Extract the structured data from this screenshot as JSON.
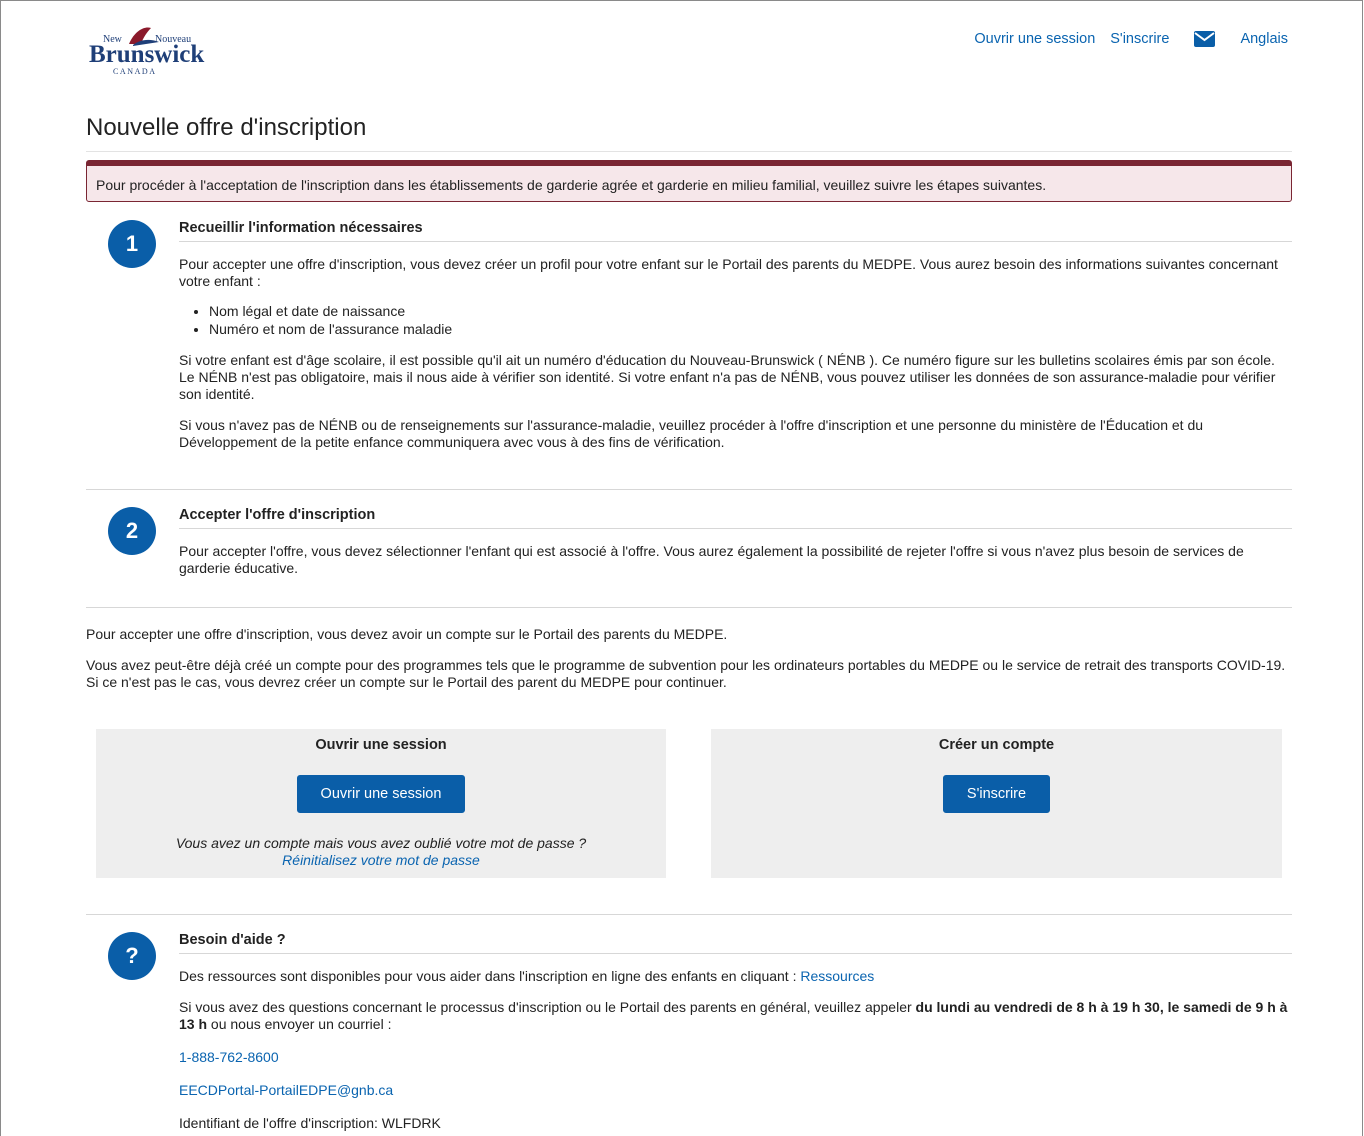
{
  "brand": {
    "logo_text_new": "New",
    "logo_text_nouveau": "Nouveau",
    "logo_text_main": "Brunswick",
    "logo_text_country": "C A N A D A"
  },
  "topnav": {
    "login": "Ouvrir une session",
    "register": "S'inscrire",
    "mail_icon": "envelope-icon",
    "language": "Anglais"
  },
  "page": {
    "title": "Nouvelle offre d'inscription",
    "alert": "Pour procéder à l'acceptation de l'inscription dans les établissements de garderie agrée et garderie en milieu familial, veuillez suivre les étapes suivantes."
  },
  "step1": {
    "number": "1",
    "heading": "Recueillir l'information nécessaires",
    "intro": "Pour accepter une offre d'inscription, vous devez créer un profil pour votre enfant sur le Portail des parents du MEDPE. Vous aurez besoin des informations suivantes concernant votre enfant :",
    "bullets": [
      "Nom légal et date de naissance",
      "Numéro et nom de l'assurance maladie"
    ],
    "para2": "Si votre enfant est d'âge scolaire, il est possible qu'il ait un numéro d'éducation du Nouveau-Brunswick ( NÉNB ). Ce numéro figure sur les bulletins scolaires émis par son école. Le NÉNB n'est pas obligatoire, mais il nous aide à vérifier son identité. Si votre enfant n'a pas de NÉNB, vous pouvez utiliser les données de son assurance-maladie pour vérifier son identité.",
    "para3": "Si vous n'avez pas de NÉNB ou de renseignements sur l'assurance-maladie, veuillez procéder à l'offre d'inscription et une personne du ministère de l'Éducation et du Développement de la petite enfance communiquera avec vous à des fins de vérification."
  },
  "step2": {
    "number": "2",
    "heading": "Accepter l'offre d'inscription",
    "text": "Pour accepter l'offre, vous devez sélectionner l'enfant qui est associé à l'offre. Vous aurez également la possibilité de rejeter l'offre si vous n'avez plus besoin de services de garderie éducative."
  },
  "account": {
    "line1": "Pour accepter une offre d'inscription, vous devez avoir un compte sur le Portail des parents du MEDPE.",
    "line2": "Vous avez peut-être déjà créé un compte pour des programmes tels que le programme de subvention pour les ordinateurs portables du MEDPE ou le service de retrait des transports COVID-19. Si ce n'est pas le cas, vous devrez créer un compte sur le Portail des parent du MEDPE pour continuer."
  },
  "login_card": {
    "heading": "Ouvrir une session",
    "button": "Ouvrir une session",
    "forgot_text": "Vous avez un compte mais vous avez oublié votre mot de passe ?",
    "reset_link": "Réinitialisez votre mot de passe"
  },
  "register_card": {
    "heading": "Créer un compte",
    "button": "S'inscrire"
  },
  "help": {
    "badge": "?",
    "heading": "Besoin d'aide ?",
    "resources_text": "Des ressources sont disponibles pour vous aider dans l'inscription en ligne des enfants en cliquant : ",
    "resources_link": "Ressources",
    "questions_text": "Si vous avez des questions concernant le processus d'inscription ou le Portail des parents en général, veuillez appeler ",
    "hours": "du lundi au vendredi de 8 h à 19 h 30, le samedi de 9 h à 13 h",
    "questions_tail": " ou nous envoyer un courriel :",
    "phone": "1-888-762-8600",
    "email": "EECDPortal-PortailEDPE@gnb.ca",
    "offer_id_label": "Identifiant de l'offre d'inscription: ",
    "offer_id": "WLFDRK"
  },
  "colors": {
    "primary": "#0a5ea8",
    "link": "#0a64b0",
    "alert_border": "#7a2633",
    "alert_bg": "#f6e7ea",
    "card_bg": "#eeeeee"
  }
}
